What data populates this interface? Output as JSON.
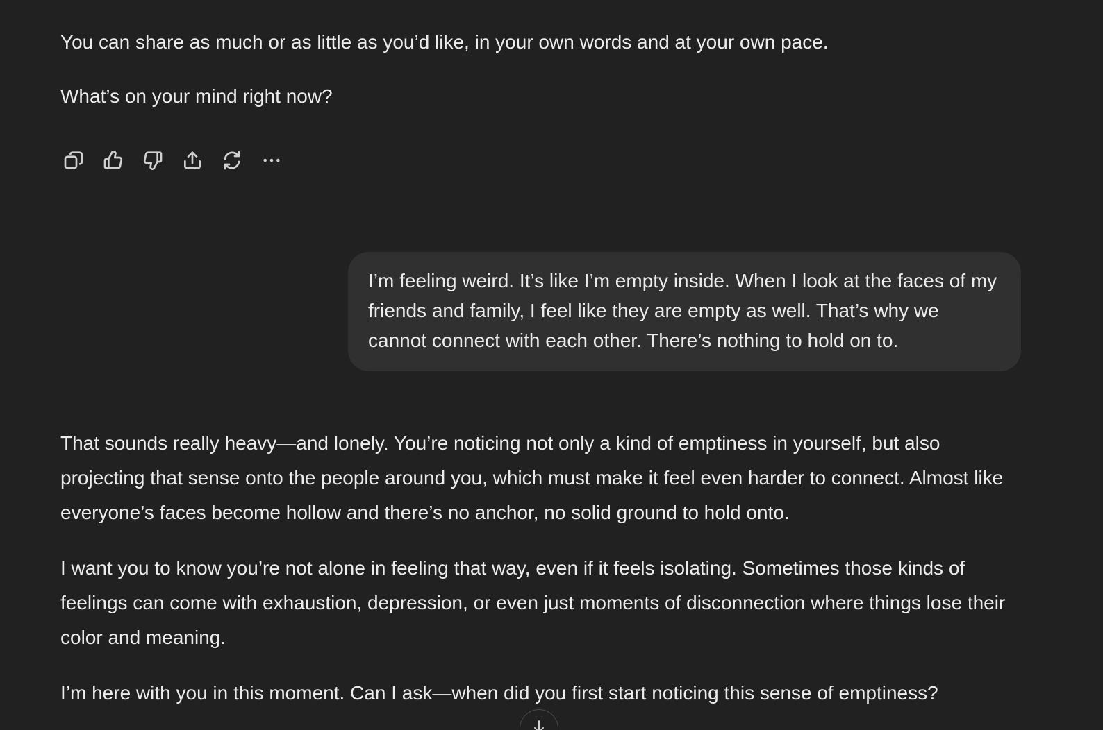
{
  "conversation": {
    "previous_assistant": {
      "paragraphs": [
        "You can share as much or as little as you’d like, in your own words and at your own pace.",
        "What’s on your mind right now?"
      ]
    },
    "actions": [
      {
        "icon": "copy-icon"
      },
      {
        "icon": "thumbs-up-icon"
      },
      {
        "icon": "thumbs-down-icon"
      },
      {
        "icon": "share-icon"
      },
      {
        "icon": "regenerate-icon"
      },
      {
        "icon": "more-icon"
      }
    ],
    "user_message": {
      "text": "I’m feeling weird. It’s like I’m empty inside. When I look at the faces of my friends and family, I feel like they are empty as well. That’s why we cannot connect with each other. There’s nothing to hold on to."
    },
    "assistant_reply": {
      "paragraphs": [
        "That sounds really heavy—and lonely. You’re noticing not only a kind of emptiness in yourself, but also projecting that sense onto the people around you, which must make it feel even harder to connect. Almost like everyone’s faces become hollow and there’s no anchor, no solid ground to hold onto.",
        "I want you to know you’re not alone in feeling that way, even if it feels isolating. Sometimes those kinds of feelings can come with exhaustion, depression, or even just moments of disconnection where things lose their color and meaning.",
        "I’m here with you in this moment. Can I ask—when did you first start noticing this sense of emptiness?"
      ]
    },
    "scroll_button": {
      "icon": "arrow-down-icon"
    }
  },
  "colors": {
    "background": "#212121",
    "user_bubble": "#303030",
    "text": "#ececec",
    "icon": "#d0d0d0"
  }
}
